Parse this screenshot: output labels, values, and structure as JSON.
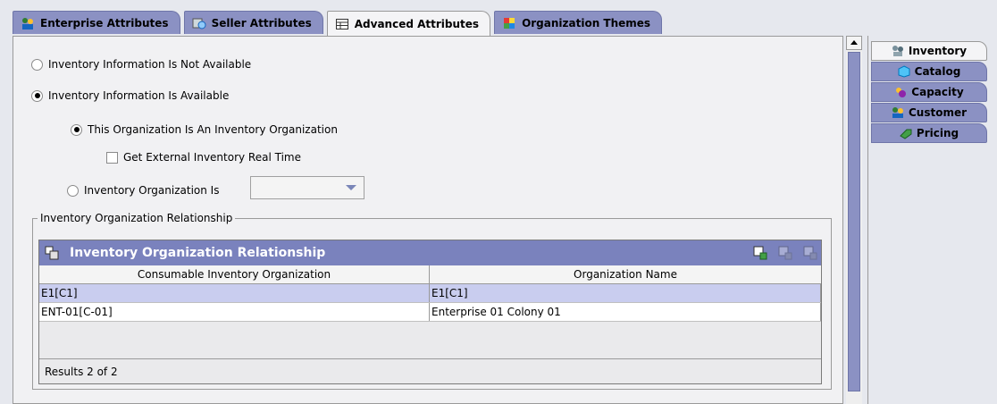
{
  "top_tabs": [
    {
      "label": "Enterprise Attributes",
      "icon": "enterprise-icon"
    },
    {
      "label": "Seller Attributes",
      "icon": "seller-icon"
    },
    {
      "label": "Advanced Attributes",
      "icon": "table-icon",
      "active": true
    },
    {
      "label": "Organization Themes",
      "icon": "themes-icon"
    }
  ],
  "options": {
    "not_available": "Inventory Information Is Not Available",
    "available": "Inventory Information Is Available",
    "is_inventory_org": "This Organization Is An Inventory Organization",
    "get_external": "Get External Inventory Real Time",
    "inventory_org_is": "Inventory Organization Is",
    "inventory_org_value": ""
  },
  "relationship": {
    "group_label": "Inventory Organization Relationship",
    "grid_title": "Inventory Organization Relationship",
    "columns": [
      "Consumable Inventory Organization",
      "Organization Name"
    ],
    "rows": [
      [
        "E1[C1]",
        "E1[C1]"
      ],
      [
        "ENT-01[C-01]",
        "Enterprise 01 Colony 01"
      ]
    ],
    "results": "Results 2 of 2"
  },
  "side_tabs": [
    {
      "label": "Inventory",
      "icon": "inventory-icon",
      "active": true
    },
    {
      "label": "Catalog",
      "icon": "catalog-icon"
    },
    {
      "label": "Capacity",
      "icon": "capacity-icon"
    },
    {
      "label": "Customer",
      "icon": "customer-icon"
    },
    {
      "label": "Pricing",
      "icon": "pricing-icon"
    }
  ],
  "colors": {
    "tab": "#8b91c3",
    "grid_header": "#7a82bd",
    "selected_row": "#c9cdef"
  }
}
